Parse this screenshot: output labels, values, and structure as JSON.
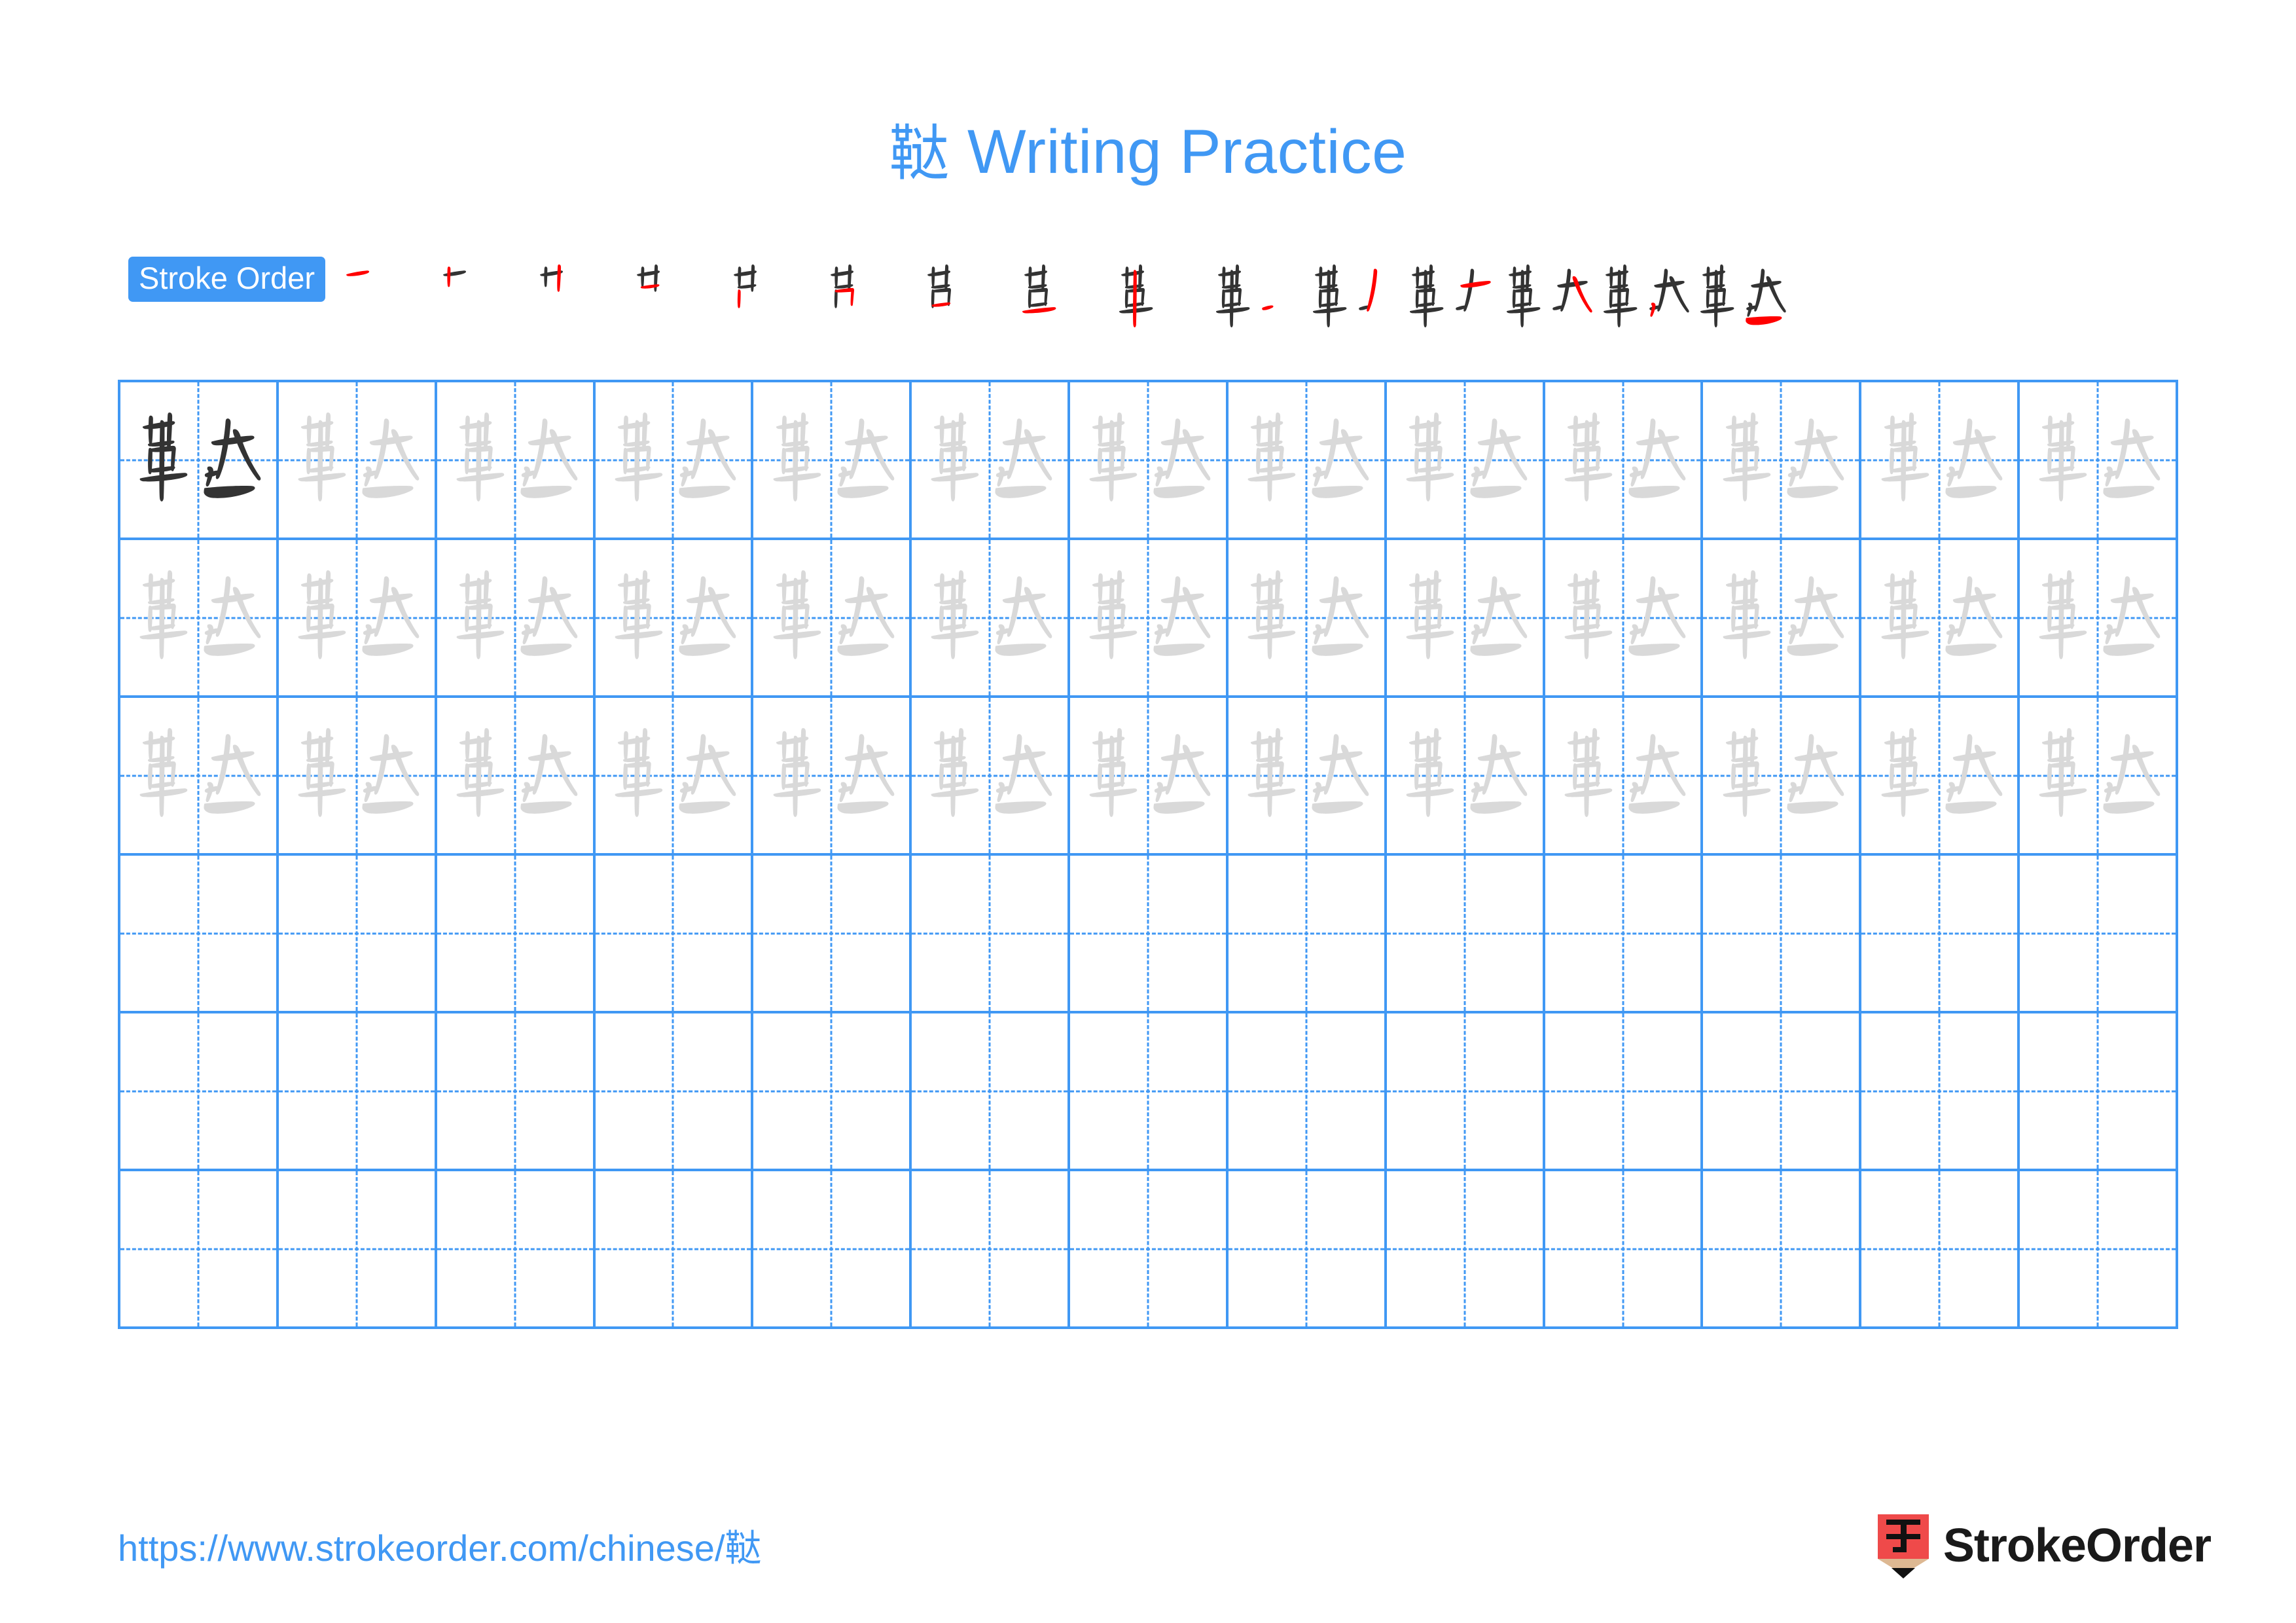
{
  "page": {
    "character": "鞑",
    "title_suffix": " Writing Practice",
    "accent_color": "#4098f4",
    "stroke_new_color": "#ff0000",
    "stroke_done_color": "#333333",
    "trace_color": "#d9d9d9"
  },
  "stroke_order": {
    "badge_label": "Stroke Order",
    "total_steps": 15,
    "steps": [
      {
        "index": 1,
        "name": "stroke-step-1"
      },
      {
        "index": 2,
        "name": "stroke-step-2"
      },
      {
        "index": 3,
        "name": "stroke-step-3"
      },
      {
        "index": 4,
        "name": "stroke-step-4"
      },
      {
        "index": 5,
        "name": "stroke-step-5"
      },
      {
        "index": 6,
        "name": "stroke-step-6"
      },
      {
        "index": 7,
        "name": "stroke-step-7"
      },
      {
        "index": 8,
        "name": "stroke-step-8"
      },
      {
        "index": 9,
        "name": "stroke-step-9"
      },
      {
        "index": 10,
        "name": "stroke-step-10"
      },
      {
        "index": 11,
        "name": "stroke-step-11"
      },
      {
        "index": 12,
        "name": "stroke-step-12"
      },
      {
        "index": 13,
        "name": "stroke-step-13"
      },
      {
        "index": 14,
        "name": "stroke-step-14"
      },
      {
        "index": 15,
        "name": "stroke-step-15"
      }
    ]
  },
  "practice_grid": {
    "columns": 13,
    "rows": 6,
    "filled_rows": 3,
    "empty_rows": 3,
    "first_cell_style": "dark",
    "other_filled_style": "light"
  },
  "footer": {
    "url": "https://www.strokeorder.com/chinese/鞑",
    "logo_text": "StrokeOrder",
    "logo_glyph": "字",
    "logo_body_color": "#ef4a4a",
    "logo_wood_color": "#ddb892",
    "logo_tip_color": "#111111"
  }
}
